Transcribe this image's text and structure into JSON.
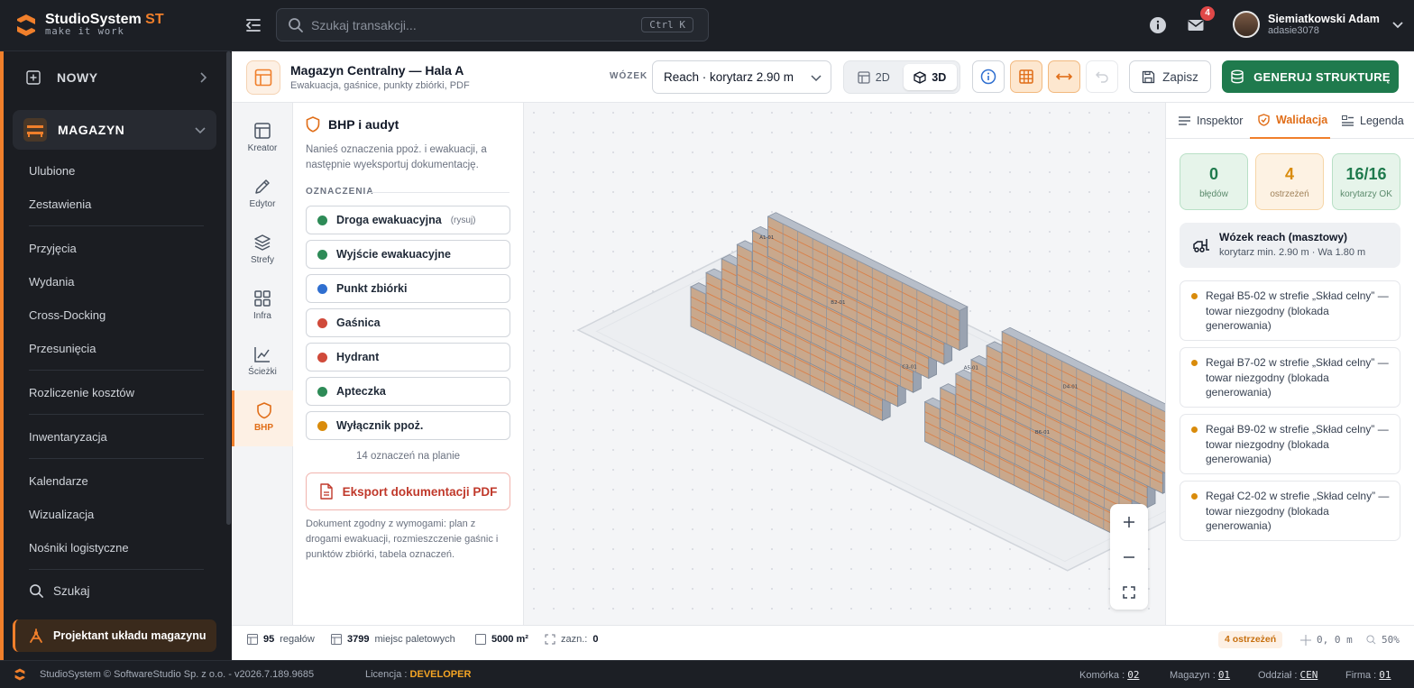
{
  "app": {
    "name": "StudioSystem",
    "name_suffix": "ST",
    "tagline": "make it work"
  },
  "search": {
    "placeholder": "Szukaj transakcji...",
    "shortcut": "Ctrl K"
  },
  "notifications": {
    "count": "4"
  },
  "user": {
    "name": "Siemiatkowski Adam",
    "login": "adasie3078"
  },
  "sidebar": {
    "new_label": "NOWY",
    "section_label": "MAGAZYN",
    "items": [
      "Ulubione",
      "Zestawienia",
      "Przyjęcia",
      "Wydania",
      "Cross-Docking",
      "Przesunięcia",
      "Rozliczenie kosztów",
      "Inwentaryzacja",
      "Kalendarze",
      "Wizualizacja",
      "Nośniki logistyczne"
    ],
    "search_label": "Szukaj",
    "active_label": "Projektant układu magazynu"
  },
  "header": {
    "title": "Magazyn Centralny — Hala A",
    "subtitle": "Ewakuacja, gaśnice, punkty zbiórki, PDF",
    "forklift_label": "WÓZEK",
    "forklift_value": "Reach · korytarz 2.90 m",
    "view_2d": "2D",
    "view_3d": "3D",
    "save_label": "Zapisz",
    "generate_label": "GENERUJ STRUKTURĘ"
  },
  "rail": [
    "Kreator",
    "Edytor",
    "Strefy",
    "Infra",
    "Ścieżki",
    "BHP"
  ],
  "panel": {
    "title": "BHP i audyt",
    "description": "Nanieś oznaczenia ppoż. i ewakuacji, a następnie wyeksportuj dokumentację.",
    "section": "OZNACZENIA",
    "markers": [
      {
        "label": "Droga ewakuacyjna",
        "hint": "(rysuj)",
        "color": "#2e8b57"
      },
      {
        "label": "Wyjście ewakuacyjne",
        "hint": "",
        "color": "#2e8b57"
      },
      {
        "label": "Punkt zbiórki",
        "hint": "",
        "color": "#2f6fd0"
      },
      {
        "label": "Gaśnica",
        "hint": "",
        "color": "#d04a3a"
      },
      {
        "label": "Hydrant",
        "hint": "",
        "color": "#d04a3a"
      },
      {
        "label": "Apteczka",
        "hint": "",
        "color": "#2e8b57"
      },
      {
        "label": "Wyłącznik ppoż.",
        "hint": "",
        "color": "#d98b0b"
      }
    ],
    "count_text": "14 oznaczeń na planie",
    "pdf_label": "Eksport dokumentacji PDF",
    "note": "Dokument zgodny z wymogami: plan z drogami ewakuacji, rozmieszczenie gaśnic i punktów zbiórki, tabela oznaczeń."
  },
  "right_panel": {
    "tabs": [
      "Inspektor",
      "Walidacja",
      "Legenda"
    ],
    "stats": [
      {
        "value": "0",
        "label": "błędów"
      },
      {
        "value": "4",
        "label": "ostrzeżeń"
      },
      {
        "value": "16/16",
        "label": "korytarzy OK"
      }
    ],
    "forklift_title": "Wózek reach (masztowy)",
    "forklift_sub": "korytarz min. 2.90 m · Wa 1.80 m",
    "warnings": [
      "Regał B5-02 w strefie „Skład celny” — towar niezgodny (blokada generowania)",
      "Regał B7-02 w strefie „Skład celny” — towar niezgodny (blokada generowania)",
      "Regał B9-02 w strefie „Skład celny” — towar niezgodny (blokada generowania)",
      "Regał C2-02 w strefie „Skład celny” — towar niezgodny (blokada generowania)"
    ]
  },
  "status": {
    "racks": "95",
    "racks_label": "regałów",
    "pallets": "3799",
    "pallets_label": "miejsc paletowych",
    "area": "5000 m²",
    "selected_label": "zazn.:",
    "selected": "0",
    "warnings_pill": "4 ostrzeżeń",
    "coords": "0, 0 m",
    "zoom": "50%"
  },
  "footer": {
    "copyright": "StudioSystem © SoftwareStudio Sp. z o.o. - v2026.7.189.9685",
    "license_label": "Licencja :",
    "license_value": "DEVELOPER",
    "cell_label": "Komórka :",
    "cell_value": "02",
    "warehouse_label": "Magazyn :",
    "warehouse_value": "01",
    "branch_label": "Oddział :",
    "branch_value": "CEN",
    "company_label": "Firma :",
    "company_value": "01"
  },
  "colors": {
    "accent": "#f07f2b",
    "primary_green": "#1f7a4d",
    "warning": "#d98b0b"
  }
}
